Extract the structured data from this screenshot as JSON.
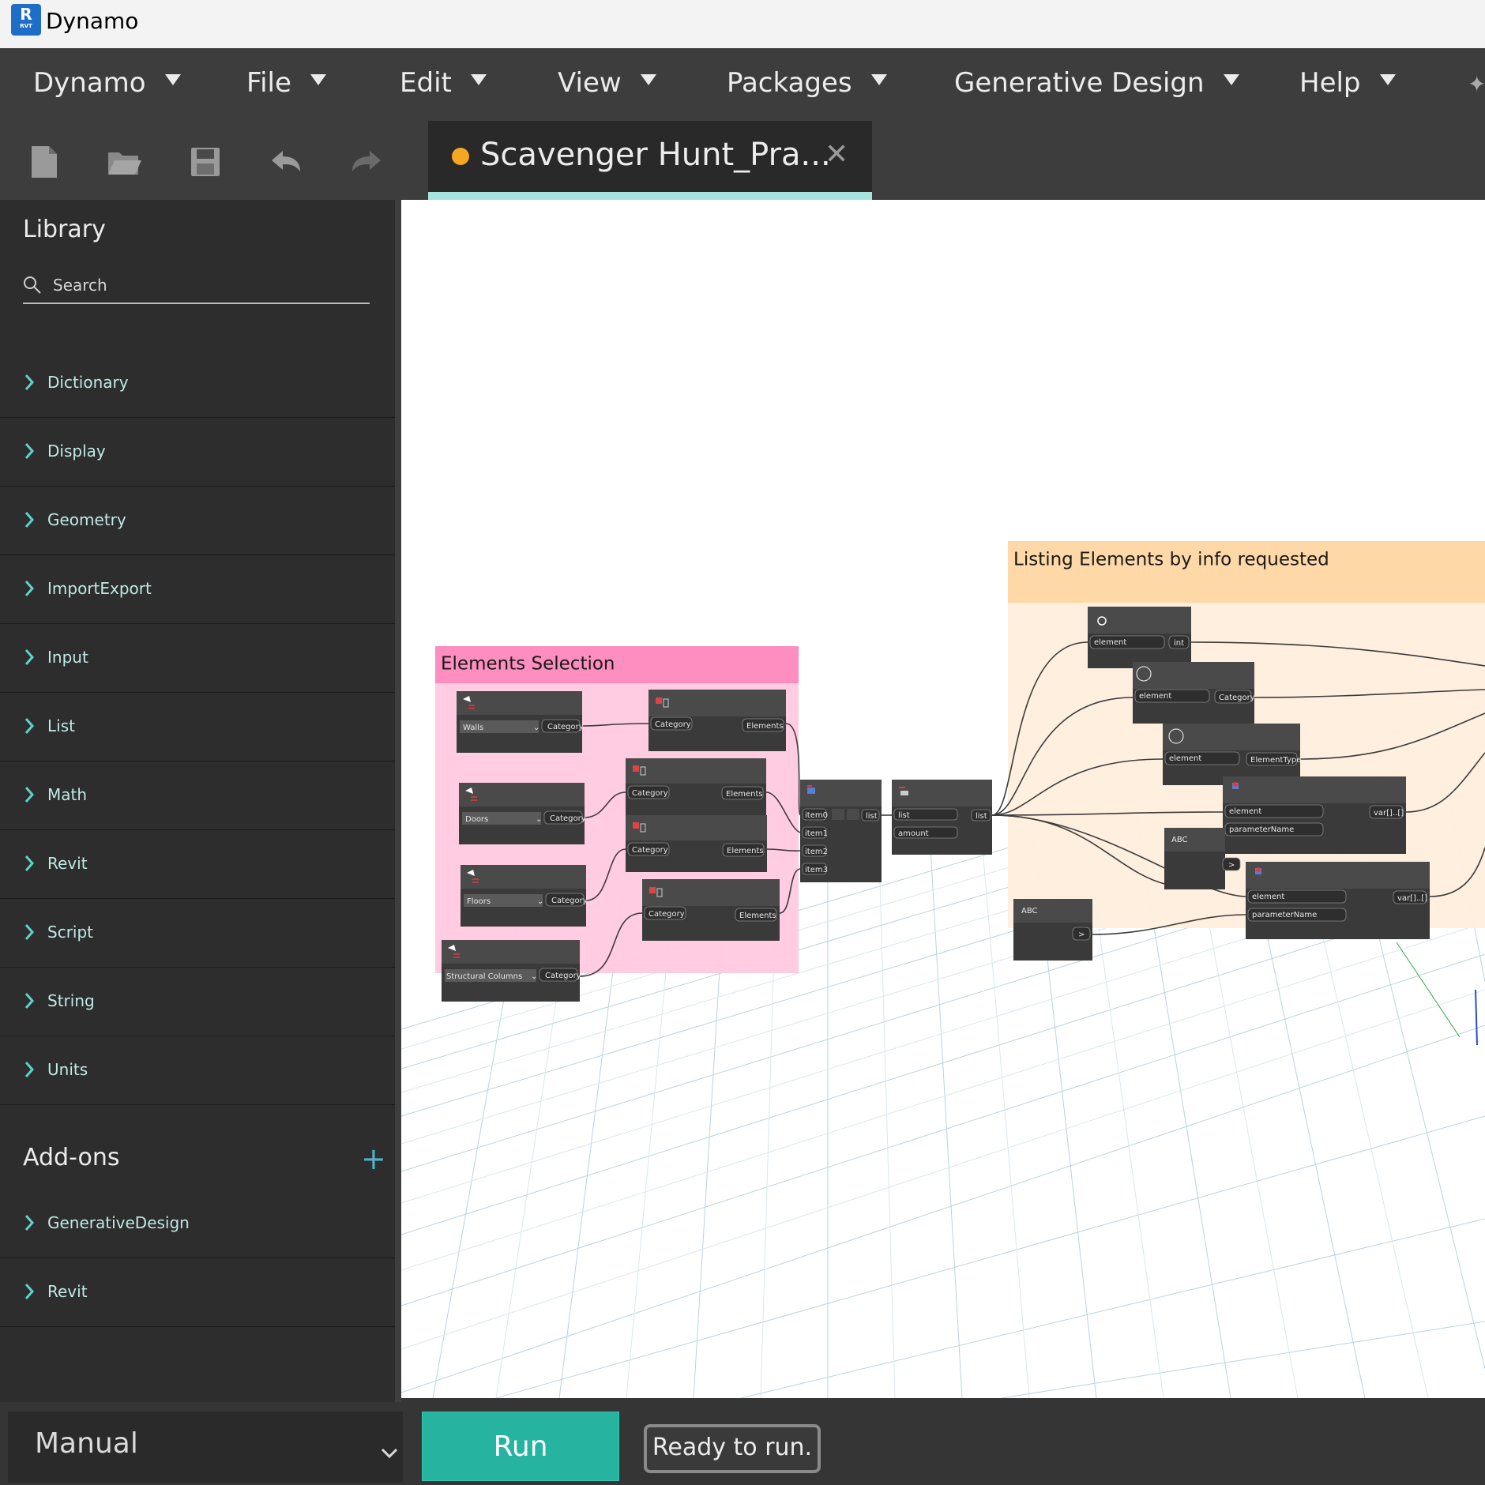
{
  "window": {
    "app_title": "Dynamo",
    "logo_letter": "R",
    "logo_sub": "RVT"
  },
  "menu": [
    {
      "label": "Dynamo"
    },
    {
      "label": "File"
    },
    {
      "label": "Edit"
    },
    {
      "label": "View"
    },
    {
      "label": "Packages"
    },
    {
      "label": "Generative Design"
    },
    {
      "label": "Help"
    }
  ],
  "toolbar": {
    "buttons": [
      "new-file-icon",
      "open-folder-icon",
      "save-icon",
      "undo-icon",
      "redo-icon"
    ]
  },
  "tab": {
    "label": "Scavenger Hunt_Pra...",
    "close": "✕",
    "modified_color": "#f5a623"
  },
  "library": {
    "title": "Library",
    "search_placeholder": "Search",
    "items": [
      {
        "label": "Dictionary"
      },
      {
        "label": "Display"
      },
      {
        "label": "Geometry"
      },
      {
        "label": "ImportExport"
      },
      {
        "label": "Input"
      },
      {
        "label": "List"
      },
      {
        "label": "Math"
      },
      {
        "label": "Revit"
      },
      {
        "label": "Script"
      },
      {
        "label": "String"
      },
      {
        "label": "Units"
      }
    ],
    "addons_title": "Add-ons",
    "addons_plus": "+",
    "addons": [
      {
        "label": "GenerativeDesign"
      },
      {
        "label": "Revit"
      }
    ]
  },
  "canvas": {
    "groups": [
      {
        "title": "Elements Selection",
        "header_color": "#ff8ec0",
        "body_color": "#ffc9e0"
      },
      {
        "title": "Listing Elements by info requested",
        "header_color": "#ffd8a8",
        "body_color": "#ffeedc"
      }
    ],
    "category_nodes": [
      {
        "value": "Walls",
        "output": "Category"
      },
      {
        "value": "Doors",
        "output": "Category"
      },
      {
        "value": "Floors",
        "output": "Category"
      },
      {
        "value": "Structural Columns",
        "output": "Category"
      }
    ],
    "elements_nodes": [
      {
        "input": "Category",
        "output": "Elements"
      },
      {
        "input": "Category",
        "output": "Elements"
      },
      {
        "input": "Category",
        "output": "Elements"
      },
      {
        "input": "Category",
        "output": "Elements"
      }
    ],
    "list_create": {
      "inputs": [
        "item0",
        "item1",
        "item2",
        "item3"
      ],
      "output": "list"
    },
    "list_op": {
      "inputs": [
        "list",
        "amount"
      ],
      "output": "list"
    },
    "info_nodes": [
      {
        "inputs": [
          "element"
        ],
        "output": "int"
      },
      {
        "inputs": [
          "element"
        ],
        "output": "Category"
      },
      {
        "inputs": [
          "element"
        ],
        "output": "ElementType"
      },
      {
        "inputs": [
          "element",
          "parameterName"
        ],
        "output": "var[]..[]"
      },
      {
        "inputs": [
          "element",
          "parameterName"
        ],
        "output": "var[]..[]"
      }
    ],
    "string_nodes": [
      {
        "label": "ABC",
        "output": ">"
      },
      {
        "label": "ABC",
        "output": ">"
      }
    ]
  },
  "status": {
    "run_mode": "Manual",
    "run_label": "Run",
    "message": "Ready to run.",
    "accent": "#26b4a0"
  }
}
